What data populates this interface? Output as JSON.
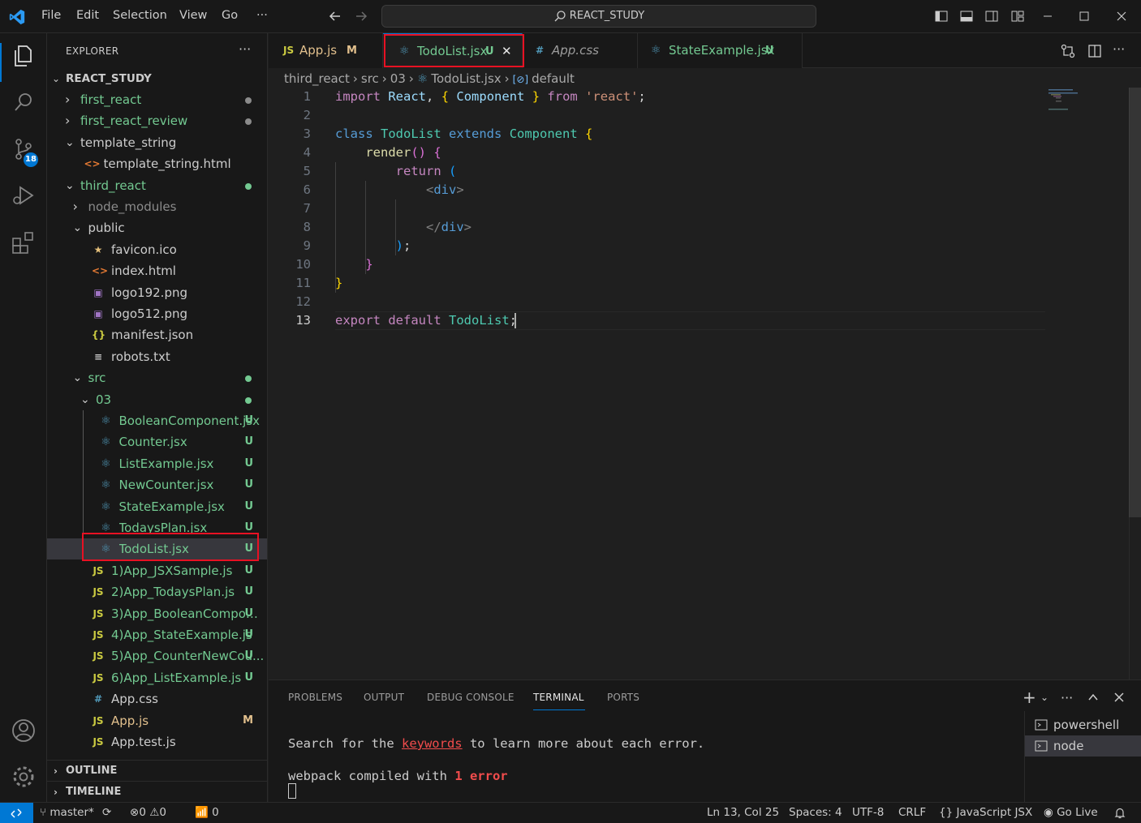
{
  "titlebar": {
    "menu": [
      "File",
      "Edit",
      "Selection",
      "View",
      "Go",
      "···"
    ],
    "search": "REACT_STUDY"
  },
  "activitybar": {
    "scm_badge": "18"
  },
  "sidebar": {
    "title": "EXPLORER",
    "more": "···",
    "root": "REACT_STUDY",
    "tree": [
      {
        "label": "first_react",
        "type": "folder",
        "state": "closed"
      },
      {
        "label": "first_react_review",
        "type": "folder",
        "state": "closed"
      },
      {
        "label": "template_string",
        "type": "folder",
        "state": "open"
      },
      {
        "label": "template_string.html",
        "type": "file",
        "icon": "<>"
      },
      {
        "label": "third_react",
        "type": "folder",
        "state": "open"
      },
      {
        "label": "node_modules",
        "type": "folder",
        "state": "closed"
      },
      {
        "label": "public",
        "type": "folder",
        "state": "open"
      },
      {
        "label": "favicon.ico",
        "type": "file",
        "icon": "★"
      },
      {
        "label": "index.html",
        "type": "file",
        "icon": "<>"
      },
      {
        "label": "logo192.png",
        "type": "file",
        "icon": "▣"
      },
      {
        "label": "logo512.png",
        "type": "file",
        "icon": "▣"
      },
      {
        "label": "manifest.json",
        "type": "file",
        "icon": "{}"
      },
      {
        "label": "robots.txt",
        "type": "file",
        "icon": "≡"
      },
      {
        "label": "src",
        "type": "folder",
        "state": "open"
      },
      {
        "label": "03",
        "type": "folder",
        "state": "open"
      },
      {
        "label": "BooleanComponent.jsx",
        "type": "file",
        "icon": "⚛",
        "status": "U"
      },
      {
        "label": "Counter.jsx",
        "type": "file",
        "icon": "⚛",
        "status": "U"
      },
      {
        "label": "ListExample.jsx",
        "type": "file",
        "icon": "⚛",
        "status": "U"
      },
      {
        "label": "NewCounter.jsx",
        "type": "file",
        "icon": "⚛",
        "status": "U"
      },
      {
        "label": "StateExample.jsx",
        "type": "file",
        "icon": "⚛",
        "status": "U"
      },
      {
        "label": "TodaysPlan.jsx",
        "type": "file",
        "icon": "⚛",
        "status": "U"
      },
      {
        "label": "TodoList.jsx",
        "type": "file",
        "icon": "⚛",
        "status": "U"
      },
      {
        "label": "1)App_JSXSample.js",
        "type": "file",
        "icon": "JS",
        "status": "U"
      },
      {
        "label": "2)App_TodaysPlan.js",
        "type": "file",
        "icon": "JS",
        "status": "U"
      },
      {
        "label": "3)App_BooleanCompon...",
        "type": "file",
        "icon": "JS",
        "status": "U"
      },
      {
        "label": "4)App_StateExample.js",
        "type": "file",
        "icon": "JS",
        "status": "U"
      },
      {
        "label": "5)App_CounterNewCou...",
        "type": "file",
        "icon": "JS",
        "status": "U"
      },
      {
        "label": "6)App_ListExample.js",
        "type": "file",
        "icon": "JS",
        "status": "U"
      },
      {
        "label": "App.css",
        "type": "file",
        "icon": "#"
      },
      {
        "label": "App.js",
        "type": "file",
        "icon": "JS",
        "status": "M"
      },
      {
        "label": "App.test.js",
        "type": "file",
        "icon": "JS"
      }
    ],
    "outline": "OUTLINE",
    "timeline": "TIMELINE"
  },
  "tabs": [
    {
      "icon": "JS",
      "label": "App.js",
      "status": "M"
    },
    {
      "icon": "⚛",
      "label": "TodoList.jsx",
      "status": "U",
      "close": "✕"
    },
    {
      "icon": "#",
      "label": "App.css"
    },
    {
      "icon": "⚛",
      "label": "StateExample.jsx",
      "status": "U"
    }
  ],
  "breadcrumb": [
    "third_react",
    "›",
    "src",
    "›",
    "03",
    "›",
    "⚛",
    "TodoList.jsx",
    "›",
    "[⊘]",
    "default"
  ],
  "editor": {
    "line_numbers": [
      "1",
      "2",
      "3",
      "4",
      "5",
      "6",
      "7",
      "8",
      "9",
      "10",
      "11",
      "12",
      "13"
    ],
    "current_line": "13"
  },
  "panel": {
    "tabs": [
      "PROBLEMS",
      "OUTPUT",
      "DEBUG CONSOLE",
      "TERMINAL",
      "PORTS"
    ],
    "active_tab": "TERMINAL",
    "terminal": {
      "line1_pre": "Search for the ",
      "line1_link": "keywords",
      "line1_post": " to learn more about each error.",
      "line2_pre": "webpack compiled with ",
      "line2_err": "1 error"
    },
    "terminals": [
      "powershell",
      "node"
    ]
  },
  "statusbar": {
    "branch": "master*",
    "errors": "0",
    "warnings": "0",
    "ports": "0",
    "position": "Ln 13, Col 25",
    "spaces": "Spaces: 4",
    "encoding": "UTF-8",
    "eol": "CRLF",
    "language": "JavaScript JSX",
    "golive": "Go Live"
  },
  "colors": {
    "accent": "#0078d4",
    "untracked": "#73c991",
    "modified": "#e2c08d",
    "highlight_box": "#e81123"
  }
}
